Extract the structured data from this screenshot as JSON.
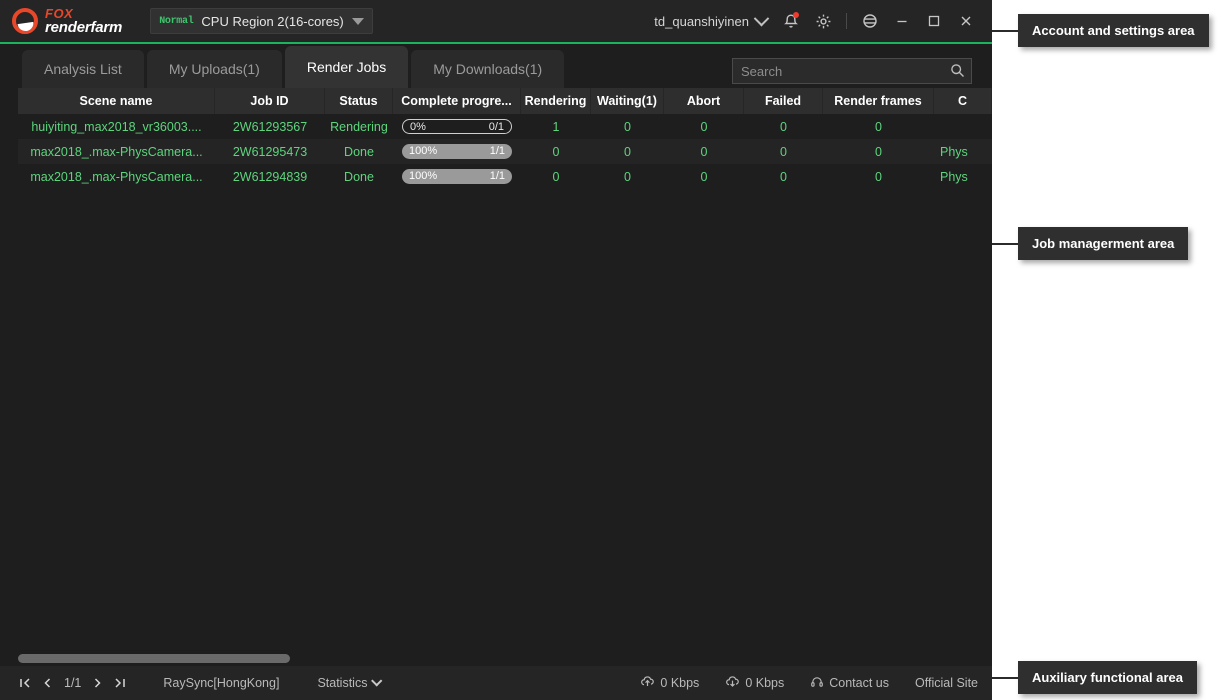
{
  "titlebar": {
    "logo_top": "FOX",
    "logo_bottom": "renderfarm",
    "node_badge": "Normal",
    "node_name": "CPU Region 2(16-cores)",
    "username": "td_quanshiyinen",
    "icons": {
      "user_chevron": "chevron-down-icon",
      "bell": "bell-icon",
      "gear": "gear-icon",
      "globe": "globe-icon",
      "minimize": "minimize-icon",
      "maximize": "maximize-icon",
      "close": "close-icon"
    },
    "accent_color": "#1bb35c"
  },
  "tabs": [
    {
      "label": "Analysis List",
      "active": false
    },
    {
      "label": "My Uploads(1)",
      "active": false
    },
    {
      "label": "Render Jobs",
      "active": true
    },
    {
      "label": "My Downloads(1)",
      "active": false
    }
  ],
  "search": {
    "value": "",
    "placeholder": "Search",
    "icon": "search-icon"
  },
  "table": {
    "columns": [
      "Scene name",
      "Job ID",
      "Status",
      "Complete progre...",
      "Rendering",
      "Waiting(1)",
      "Abort",
      "Failed",
      "Render frames",
      "C"
    ],
    "rows": [
      {
        "scene": "huiyiting_max2018_vr36003....",
        "job_id": "2W61293567",
        "status": "Rendering",
        "progress_percent": "0%",
        "progress_frames": "0/1",
        "progress_fill": 0,
        "rendering": "1",
        "waiting": "0",
        "abort": "0",
        "failed": "0",
        "render_frames": "0",
        "extra": ""
      },
      {
        "scene": "max2018_.max-PhysCamera...",
        "job_id": "2W61295473",
        "status": "Done",
        "progress_percent": "100%",
        "progress_frames": "1/1",
        "progress_fill": 100,
        "rendering": "0",
        "waiting": "0",
        "abort": "0",
        "failed": "0",
        "render_frames": "0",
        "extra": "Phys"
      },
      {
        "scene": "max2018_.max-PhysCamera...",
        "job_id": "2W61294839",
        "status": "Done",
        "progress_percent": "100%",
        "progress_frames": "1/1",
        "progress_fill": 100,
        "rendering": "0",
        "waiting": "0",
        "abort": "0",
        "failed": "0",
        "render_frames": "0",
        "extra": "Phys"
      }
    ]
  },
  "statusbar": {
    "page_first": "first-page-icon",
    "page_prev": "prev-page-icon",
    "page_label": "1/1",
    "page_next": "next-page-icon",
    "page_last": "last-page-icon",
    "raysync": "RaySync[HongKong]",
    "statistics": "Statistics",
    "upload_speed": "0 Kbps",
    "download_speed": "0 Kbps",
    "contact": "Contact us",
    "official_site": "Official Site"
  },
  "annotations": [
    {
      "label": "Account and settings area"
    },
    {
      "label": "Job managerment area"
    },
    {
      "label": "Auxiliary functional area"
    }
  ]
}
